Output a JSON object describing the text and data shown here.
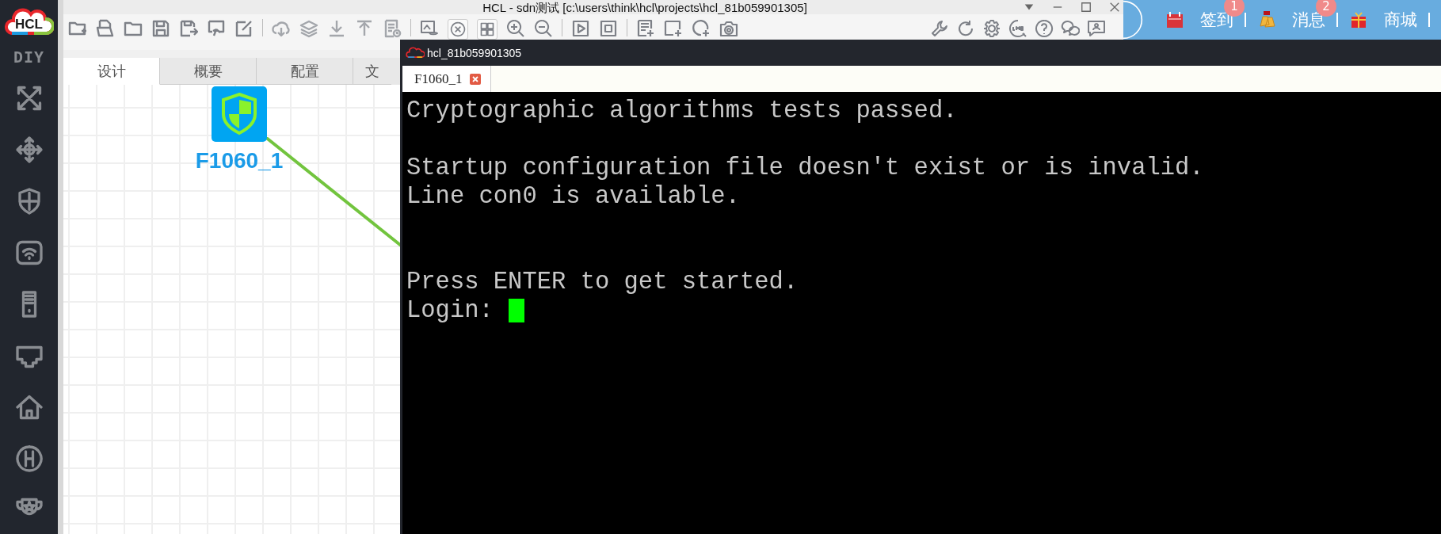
{
  "window": {
    "title": "HCL - sdn测试 [c:\\users\\think\\hcl\\projects\\hcl_81b059901305]"
  },
  "sidebar": {
    "logo": "HCL",
    "diy": "DIY"
  },
  "design_tabs": [
    {
      "label": "设计",
      "selected": true
    },
    {
      "label": "概要",
      "selected": false
    },
    {
      "label": "配置",
      "selected": false
    },
    {
      "label": "文",
      "selected": false
    }
  ],
  "canvas": {
    "devices": [
      {
        "label": "F1060_1"
      }
    ]
  },
  "top_links": [
    {
      "label": "签到",
      "badge": "1",
      "kind": "calendar"
    },
    {
      "label": "消息",
      "badge": "2",
      "kind": "bell"
    },
    {
      "label": "商城",
      "kind": "gift"
    }
  ],
  "console": {
    "title": "hcl_81b059901305",
    "cursor": true,
    "tabs": [
      {
        "label": "F1060_1",
        "selected": true
      }
    ],
    "lines": [
      {
        "kind": "text",
        "text": "Cryptographic algorithms tests passed."
      },
      {
        "kind": "blank"
      },
      {
        "kind": "text",
        "text": "Startup configuration file doesn't exist or is invalid."
      },
      {
        "kind": "text",
        "text": "Line con0 is available."
      },
      {
        "kind": "blank"
      },
      {
        "kind": "blank"
      },
      {
        "kind": "text",
        "text": "Press ENTER to get started."
      },
      {
        "kind": "text",
        "text": "Login:"
      }
    ]
  }
}
